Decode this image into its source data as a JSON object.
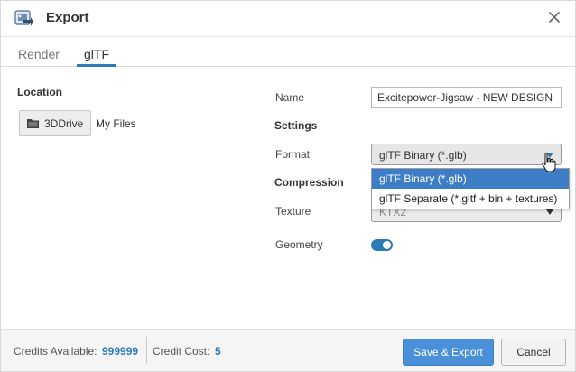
{
  "window": {
    "title": "Export",
    "app_icon": "export-app-icon",
    "close_icon": "close-icon"
  },
  "tabs": [
    {
      "label": "Render",
      "active": false
    },
    {
      "label": "glTF",
      "active": true
    }
  ],
  "location": {
    "title": "Location",
    "drive_button_label": "3DDrive",
    "drive_icon": "folder-icon",
    "path_label": "My Files"
  },
  "form": {
    "name_label": "Name",
    "name_value": "Excitepower-Jigsaw - NEW DESIGN",
    "settings_title": "Settings",
    "format_label": "Format",
    "format_value": "glTF Binary (*.glb)",
    "format_options": [
      {
        "label": "glTF Binary (*.glb)",
        "highlighted": true
      },
      {
        "label": "glTF Separate (*.gltf + bin + textures)",
        "highlighted": false
      }
    ],
    "compression_title": "Compression",
    "texture_label": "Texture",
    "texture_value": "KTX2",
    "geometry_label": "Geometry",
    "geometry_enabled": true
  },
  "footer": {
    "credits_available_label": "Credits Available:",
    "credits_available_value": "999999",
    "credit_cost_label": "Credit Cost:",
    "credit_cost_value": "5",
    "save_label": "Save & Export",
    "cancel_label": "Cancel"
  },
  "colors": {
    "accent": "#2b7ab8",
    "primary_button": "#4a90d9",
    "option_highlight": "#3d7dc5"
  }
}
